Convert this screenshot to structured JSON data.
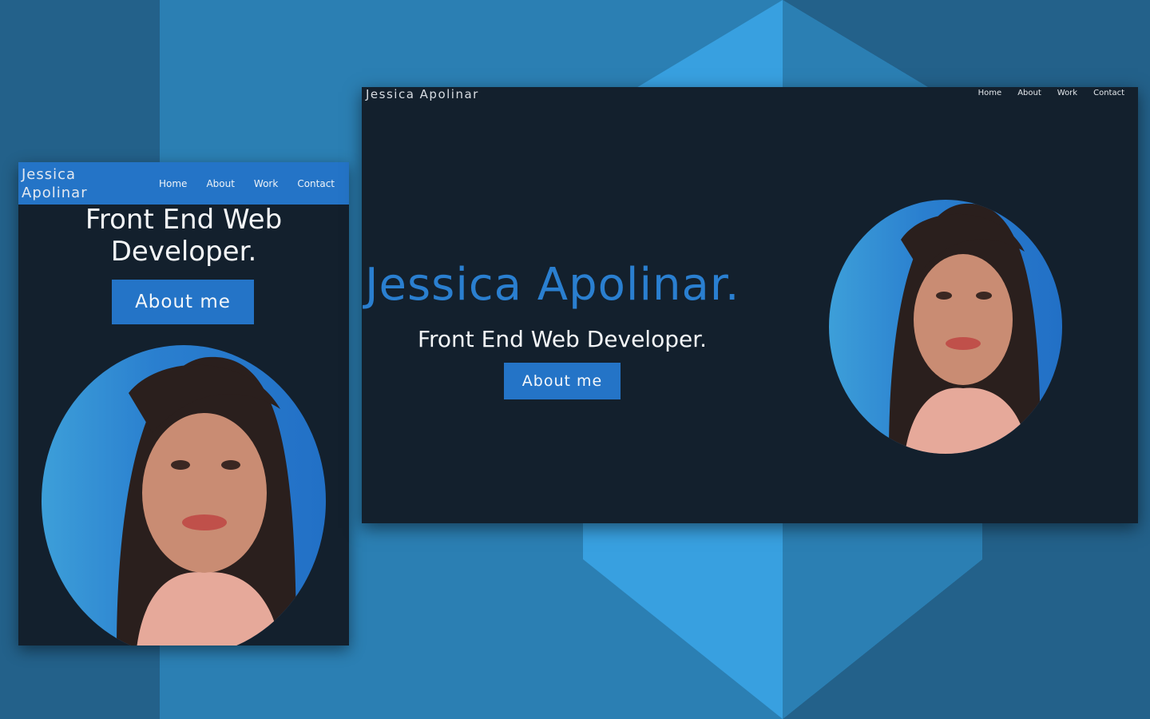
{
  "colors": {
    "background": "#23618a",
    "hexagon_light": "#38a0e0",
    "hexagon_mid": "#2b7fb3",
    "panel": "#13202d",
    "accent": "#2474c7",
    "name_text": "#2a7fd0"
  },
  "mobile": {
    "logo": "Jessica Apolinar",
    "nav": [
      "Home",
      "About",
      "Work",
      "Contact"
    ],
    "title": "Front End Web Developer.",
    "button": "About me",
    "photo": "profile-photo"
  },
  "desktop": {
    "logo": "Jessica Apolinar",
    "nav": [
      "Home",
      "About",
      "Work",
      "Contact"
    ],
    "name": "Jessica Apolinar.",
    "role": "Front End Web Developer.",
    "button": "About me",
    "photo": "profile-photo"
  }
}
